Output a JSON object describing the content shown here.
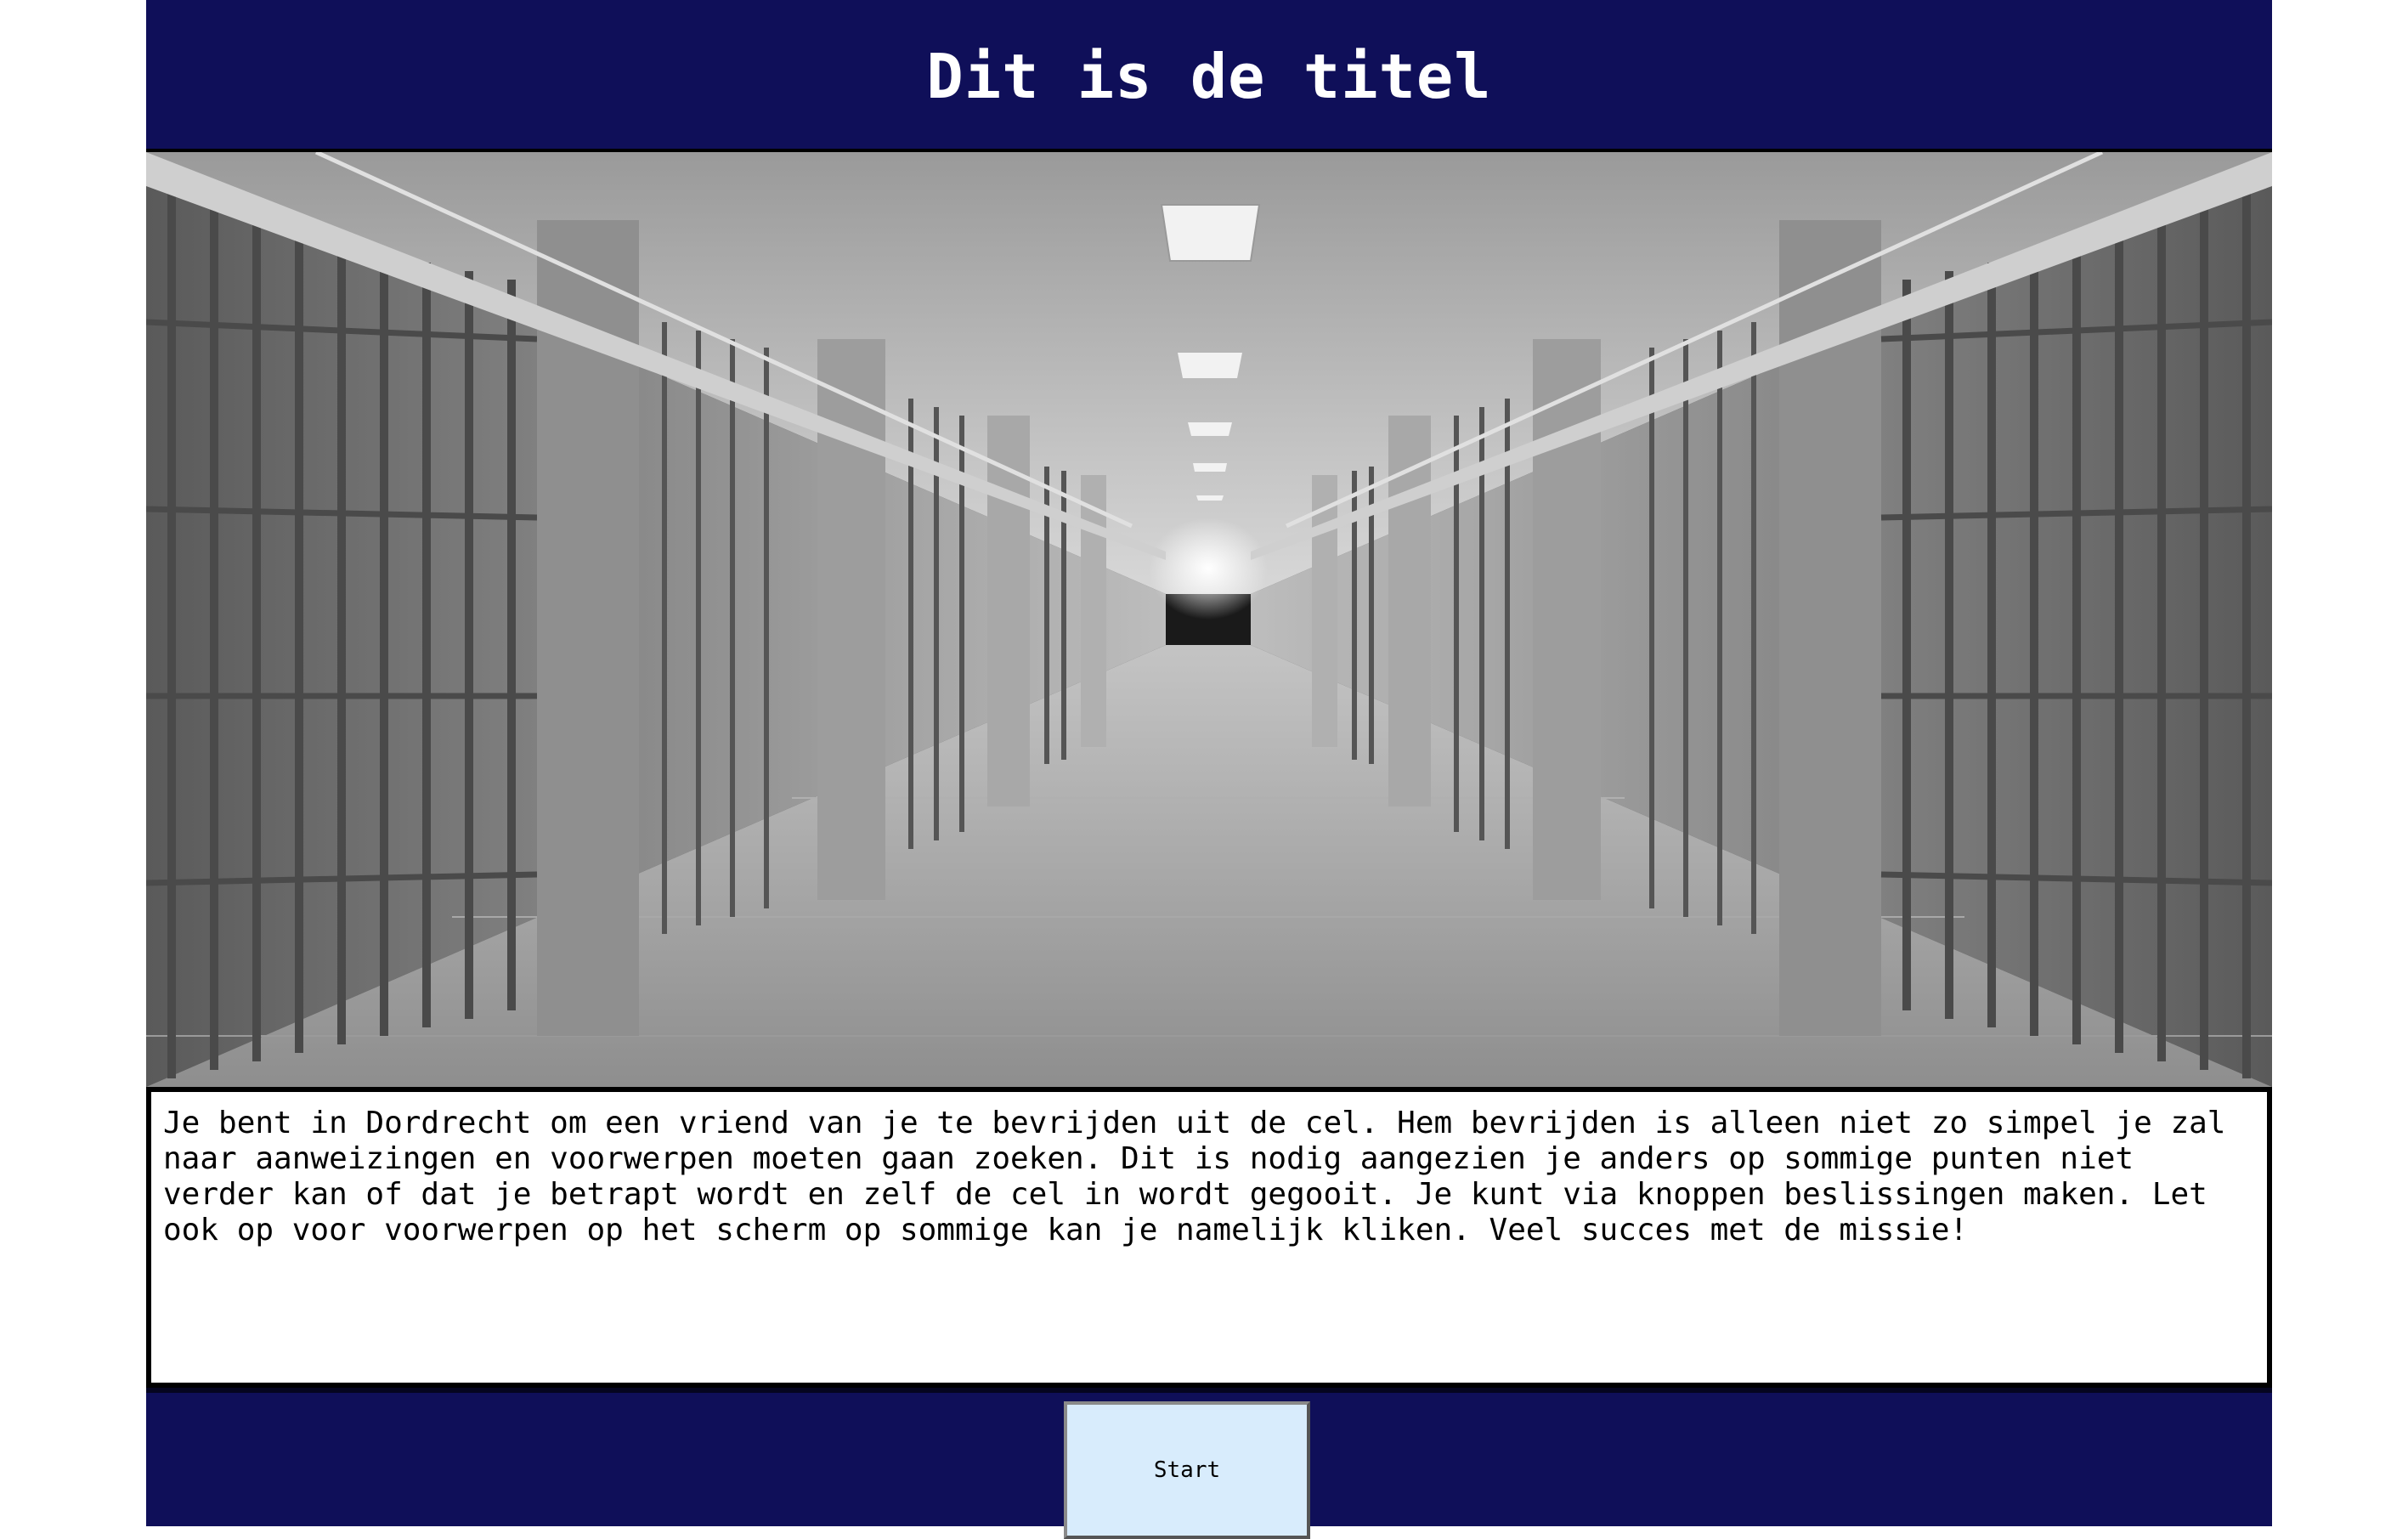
{
  "header": {
    "title": "Dit is de titel"
  },
  "scene": {
    "image_subject": "prison-corridor"
  },
  "story": {
    "text": "Je bent in Dordrecht om een vriend van je te bevrijden uit de cel. Hem bevrijden is alleen niet zo simpel je zal naar aanweizingen en voorwerpen moeten gaan zoeken. Dit is nodig aangezien je anders op sommige punten niet verder kan of dat je betrapt wordt en zelf de cel in wordt gegooit. Je kunt via knoppen beslissingen maken. Let ook op voor voorwerpen op het scherm op sommige kan je namelijk kliken. Veel succes met de missie!"
  },
  "footer": {
    "start_label": "Start"
  },
  "colors": {
    "banner": "#0f0f59",
    "button": "#d8ecfc"
  }
}
